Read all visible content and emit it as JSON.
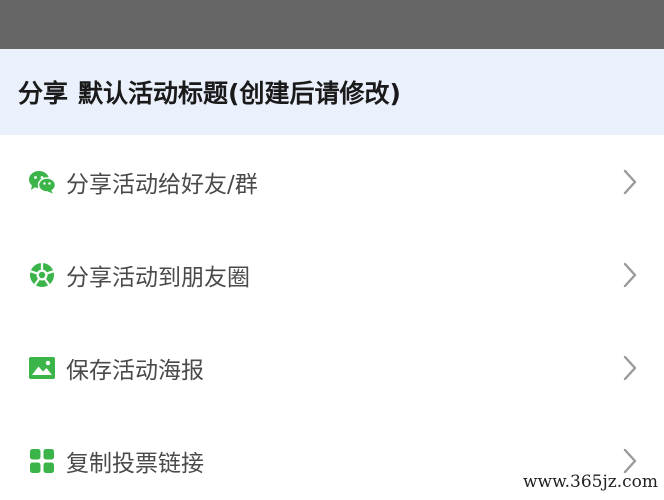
{
  "header": {
    "prefix": "分享",
    "title": "默认活动标题(创建后请修改)"
  },
  "menu": {
    "items": [
      {
        "label": "分享活动给好友/群",
        "icon": "wechat-icon"
      },
      {
        "label": "分享活动到朋友圈",
        "icon": "moments-icon"
      },
      {
        "label": "保存活动海报",
        "icon": "image-icon"
      },
      {
        "label": "复制投票链接",
        "icon": "grid-icon"
      }
    ]
  },
  "watermark": "www.365jz.com",
  "colors": {
    "accent_green": "#3bb44a",
    "header_bg": "#eaf0fc",
    "overlay": "#666666",
    "chevron": "#9a9a9a"
  }
}
